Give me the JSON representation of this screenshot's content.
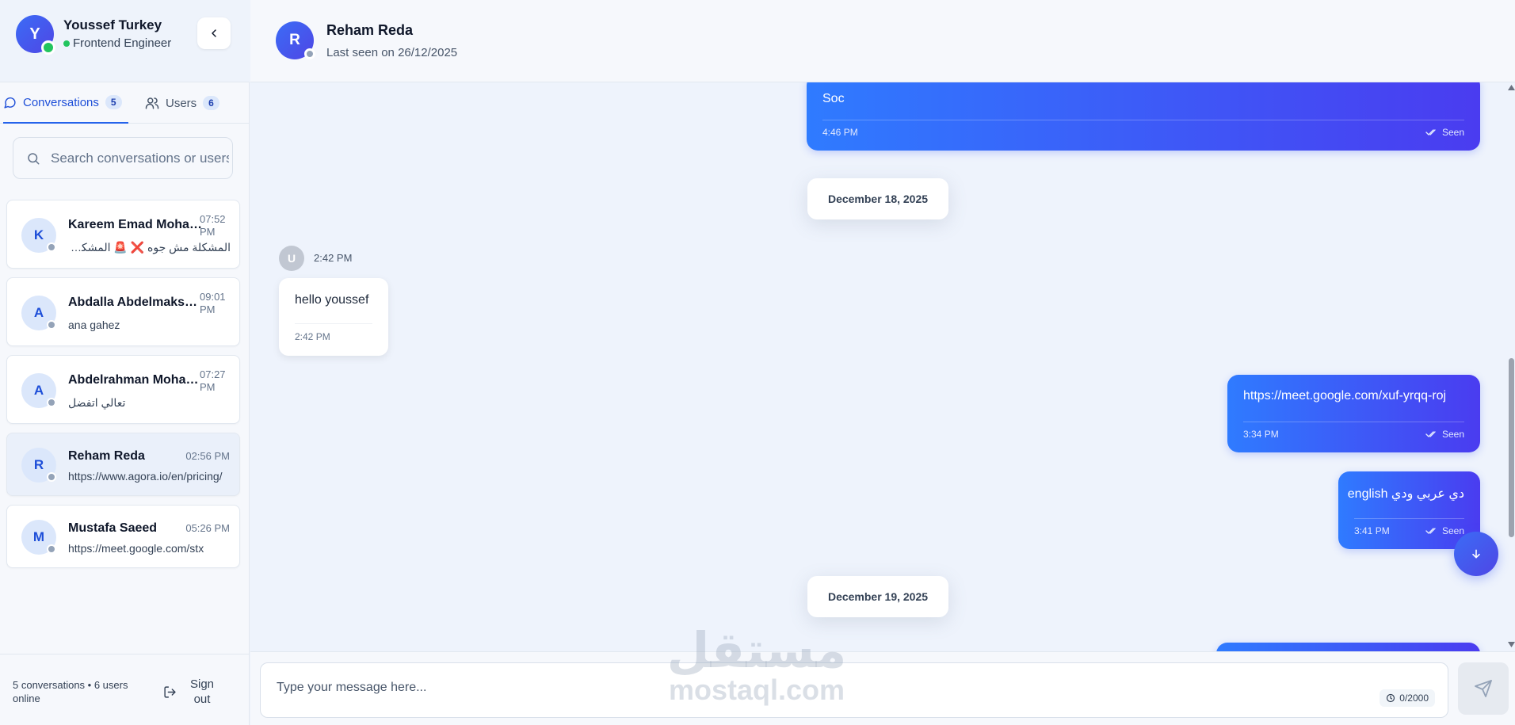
{
  "profile": {
    "initial": "Y",
    "name": "Youssef Turkey",
    "role": "Frontend Engineer"
  },
  "tabs": [
    {
      "label": "Conversations",
      "count": "5",
      "active": true
    },
    {
      "label": "Users",
      "count": "6",
      "active": false
    }
  ],
  "search": {
    "placeholder": "Search conversations or users"
  },
  "conversations": [
    {
      "initial": "K",
      "name": "Kareem Emad Mohamed",
      "time": "07:52 PM",
      "preview": "المشكلة مش جوه ❌ 🚨 المشكلة بقى؟"
    },
    {
      "initial": "A",
      "name": "Abdalla Abdelmaksoud",
      "time": "09:01 PM",
      "preview": "ana gahez"
    },
    {
      "initial": "A",
      "name": "Abdelrahman Mohamed",
      "time": "07:27 PM",
      "preview": "تعالي اتفضل"
    },
    {
      "initial": "R",
      "name": "Reham Reda",
      "time": "02:56 PM",
      "preview": "https://www.agora.io/en/pricing/"
    },
    {
      "initial": "M",
      "name": "Mustafa Saeed",
      "time": "05:26 PM",
      "preview": "https://meet.google.com/stx"
    }
  ],
  "footer": {
    "stats": "5 conversations • 6 users online",
    "signout_label": "Sign out"
  },
  "chat": {
    "initial": "R",
    "name": "Reham Reda",
    "status": "Last seen on 26/12/2025",
    "messages": {
      "m1": {
        "text": "Soc",
        "time": "4:46 PM",
        "status": "Seen"
      },
      "date1": "December 18, 2025",
      "sender_initial": "U",
      "sender_time": "2:42 PM",
      "m2": {
        "text": "hello youssef",
        "time": "2:42 PM"
      },
      "m3": {
        "text": "https://meet.google.com/xuf-yrqq-roj",
        "time": "3:34 PM",
        "status": "Seen"
      },
      "m4": {
        "text": "دي عربي ودي english",
        "time": "3:41 PM",
        "status": "Seen"
      },
      "date2": "December 19, 2025"
    }
  },
  "composer": {
    "placeholder": "Type your message here...",
    "char_count": "0/2000"
  },
  "watermark": {
    "arabic": "مستقل",
    "latin": "mostaql.com"
  },
  "colors": {
    "accent": "#2563eb",
    "online": "#22c55e",
    "offline": "#94a3b8"
  }
}
